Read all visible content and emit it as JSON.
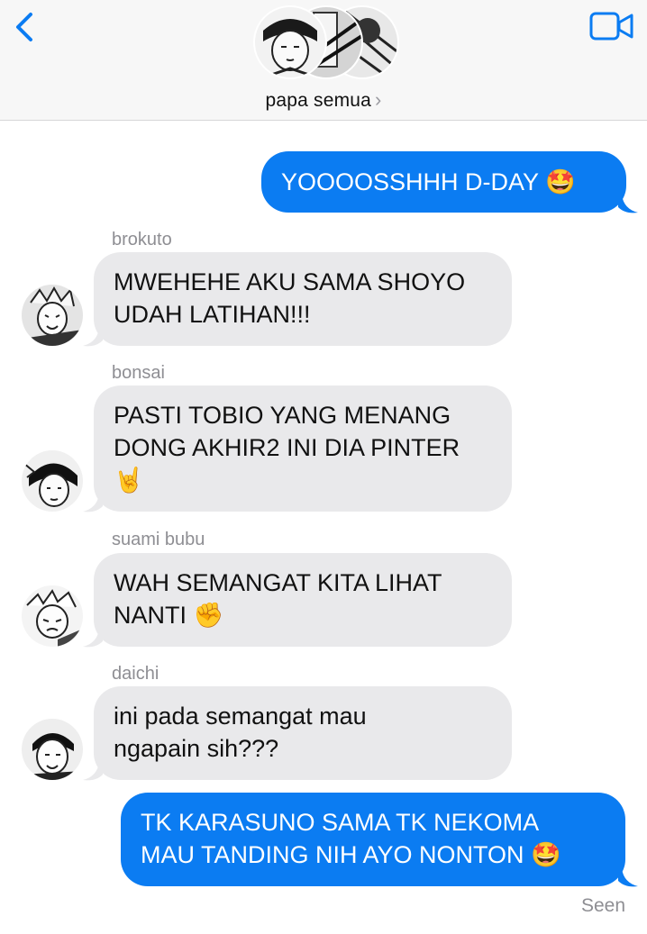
{
  "header": {
    "back_icon": "chevron-left-icon",
    "video_icon": "video-camera-icon",
    "group_name": "papa semua",
    "group_chevron": "›",
    "accent": "#0b7cf2"
  },
  "messages": [
    {
      "side": "out",
      "text": "YOOOOSSHHH D-DAY 🤩"
    },
    {
      "side": "in",
      "sender": "brokuto",
      "text": "MWEHEHE AKU SAMA SHOYO\nUDAH LATIHAN!!!"
    },
    {
      "side": "in",
      "sender": "bonsai",
      "text": "PASTI TOBIO YANG MENANG\nDONG AKHIR2 INI DIA PINTER\n🤘"
    },
    {
      "side": "in",
      "sender": "suami bubu",
      "text": "WAH SEMANGAT KITA LIHAT\nNANTI ✊"
    },
    {
      "side": "in",
      "sender": "daichi",
      "text": "ini pada semangat mau\nngapain sih???"
    },
    {
      "side": "out",
      "text": "TK KARASUNO SAMA TK NEKOMA\nMAU TANDING NIH AYO NONTON 🤩"
    }
  ],
  "status": {
    "seen": "Seen"
  },
  "colors": {
    "incoming_bubble": "#e9e9eb",
    "outgoing_bubble": "#0b7cf2",
    "meta_text": "#8e8e93"
  }
}
